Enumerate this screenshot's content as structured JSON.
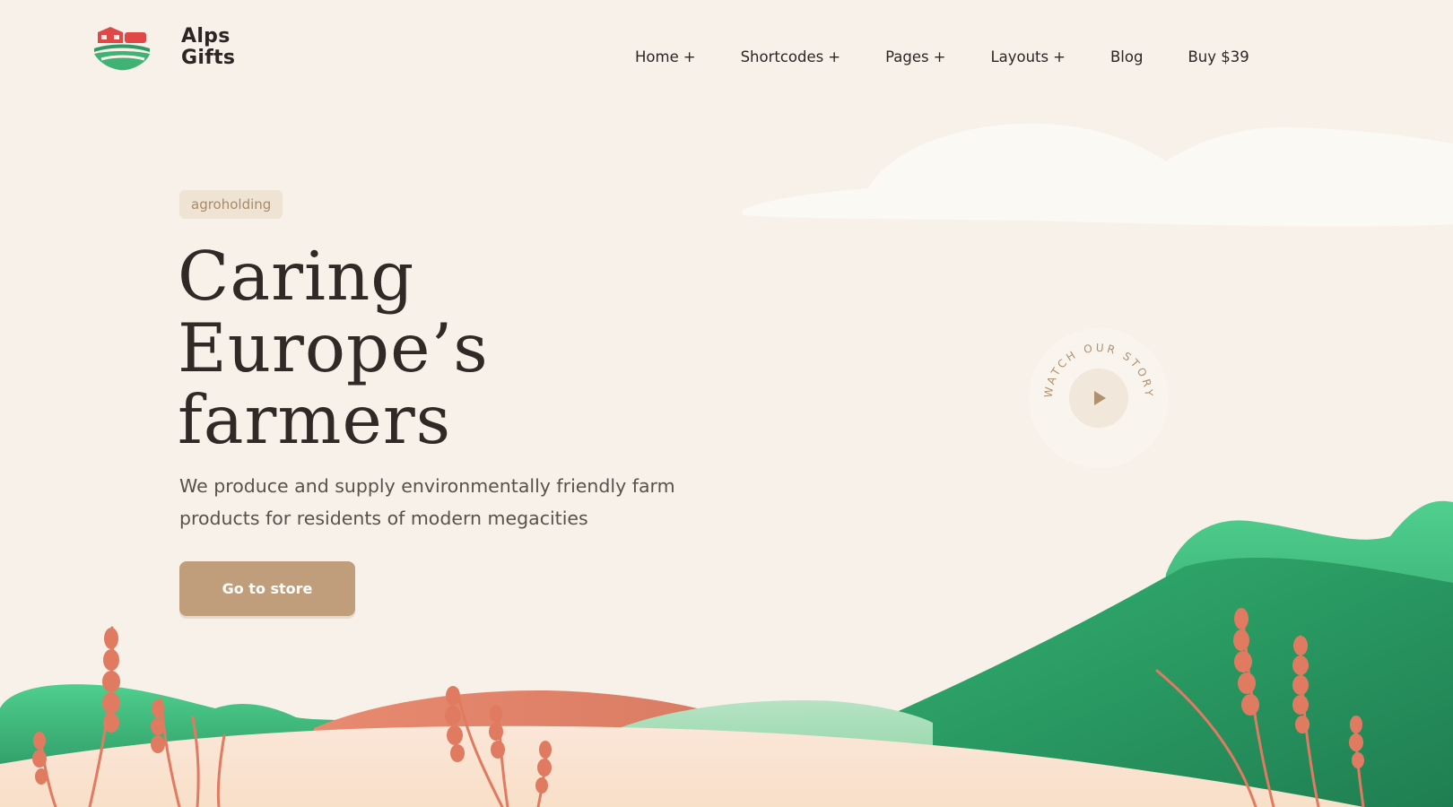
{
  "brand": {
    "name_line1": "Alps",
    "name_line2": "Gifts"
  },
  "nav": {
    "items": [
      {
        "label": "Home",
        "has_submenu": true
      },
      {
        "label": "Shortcodes",
        "has_submenu": true
      },
      {
        "label": "Pages",
        "has_submenu": true
      },
      {
        "label": "Layouts",
        "has_submenu": true
      },
      {
        "label": "Blog",
        "has_submenu": false
      },
      {
        "label": "Buy $39",
        "has_submenu": false
      }
    ],
    "submenu_marker": "+"
  },
  "hero": {
    "tag": "agroholding",
    "title_line1": "Caring",
    "title_line2": "Europe’s",
    "title_line3": "farmers",
    "subtitle": "We produce and supply environmentally friendly farm products for residents of modern megacities",
    "cta_label": "Go to store"
  },
  "story_badge": {
    "text": "WATCH OUR STORY",
    "icon": "play-icon"
  },
  "colors": {
    "background": "#f7f1ea",
    "accent": "#c19e7b",
    "green": "#2e9a63",
    "terracotta": "#e2826a",
    "text": "#2f2a26"
  }
}
